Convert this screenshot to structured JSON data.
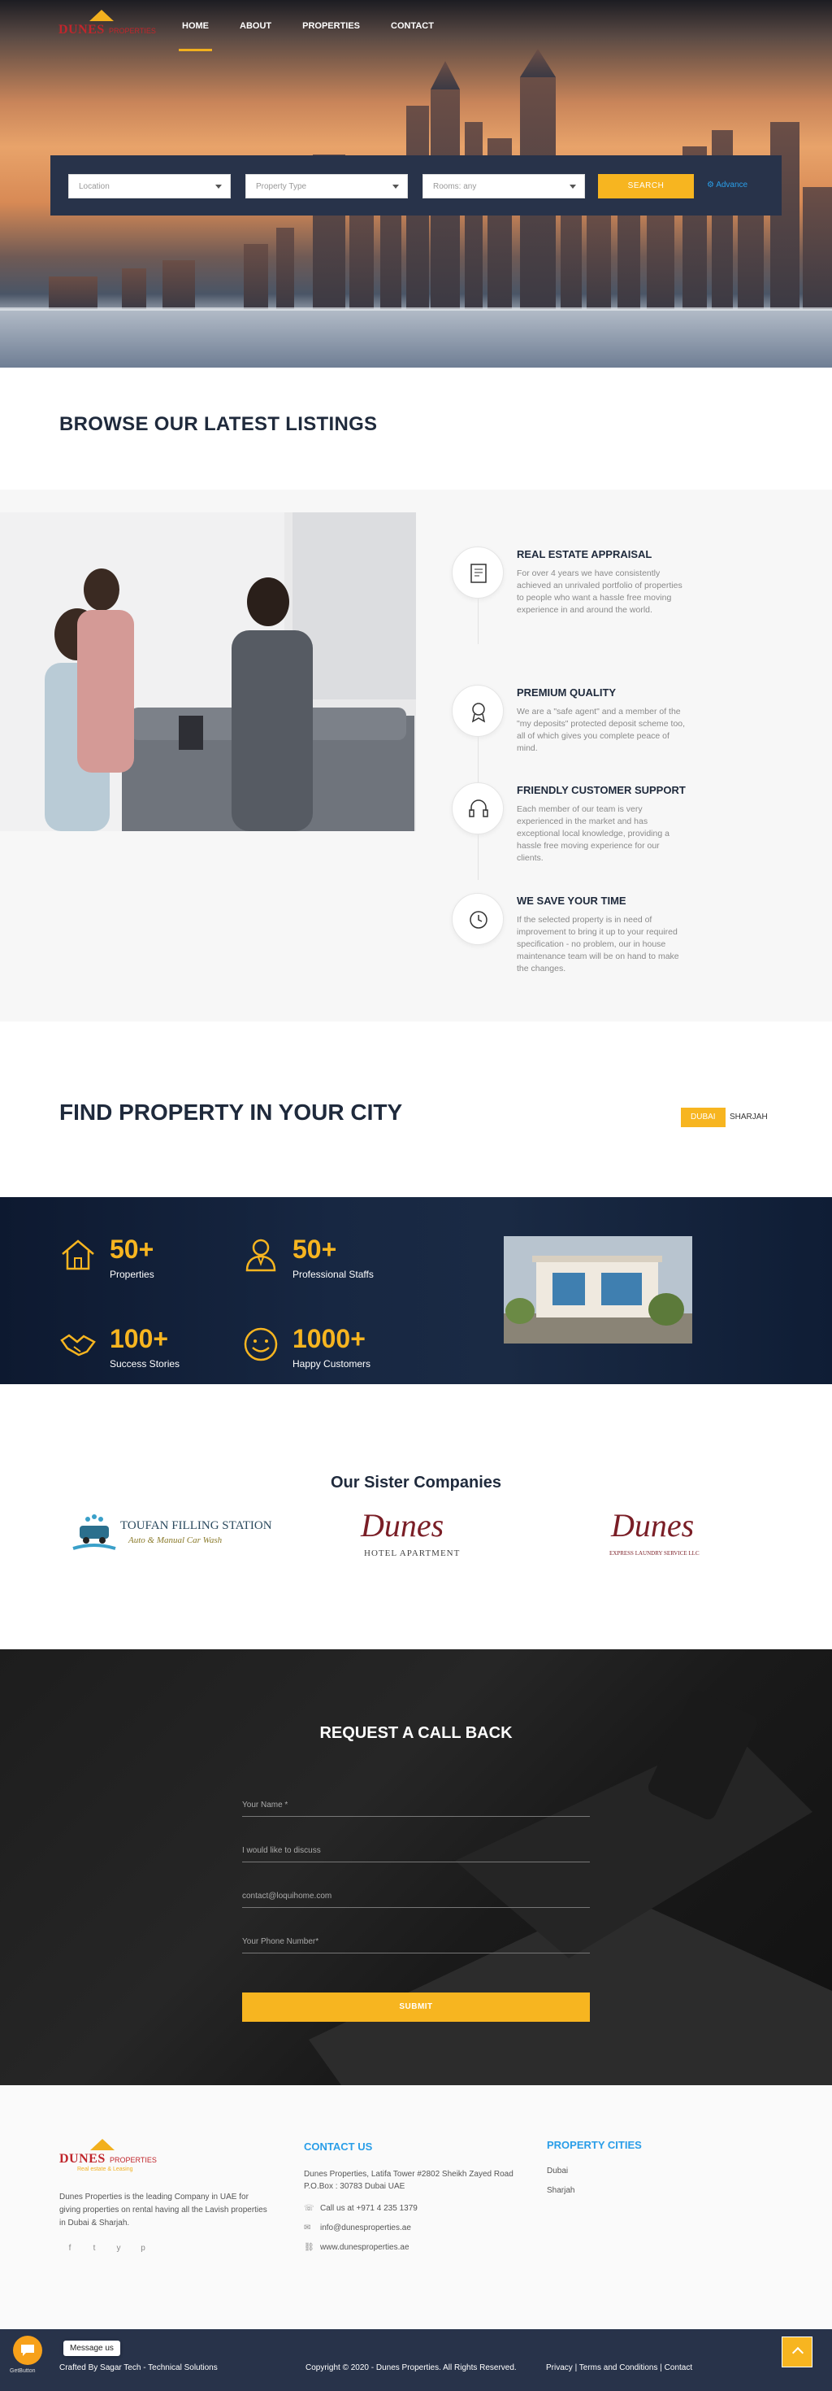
{
  "brand": {
    "name": "DUNES",
    "sub": "PROPERTIES",
    "tagline": "Real estate & Leasing"
  },
  "nav": [
    {
      "label": "HOME",
      "active": true
    },
    {
      "label": "ABOUT"
    },
    {
      "label": "PROPERTIES"
    },
    {
      "label": "CONTACT"
    }
  ],
  "search": {
    "location": "Location",
    "property_type": "Property Type",
    "rooms": "Rooms: any",
    "button": "SEARCH",
    "advance": "Advance"
  },
  "listings": {
    "title": "BROWSE OUR LATEST LISTINGS"
  },
  "features": [
    {
      "icon": "document-icon",
      "title": "REAL ESTATE APPRAISAL",
      "desc": "For over 4 years we have consistently achieved an unrivaled portfolio of properties to people who want a hassle free moving experience in and around the world."
    },
    {
      "icon": "medal-icon",
      "title": "PREMIUM QUALITY",
      "desc": "We are a \"safe agent\" and a member of the \"my deposits\" protected deposit scheme too, all of which gives you complete peace of mind."
    },
    {
      "icon": "headset-icon",
      "title": "FRIENDLY CUSTOMER SUPPORT",
      "desc": "Each member of our team is very experienced in the market and has exceptional local knowledge, providing a hassle free moving experience for our clients."
    },
    {
      "icon": "clock-money-icon",
      "title": "WE SAVE YOUR TIME",
      "desc": "If the selected property is in need of improvement to bring it up to your required specification - no problem, our in house maintenance team will be on hand to make the changes."
    }
  ],
  "city": {
    "title": "FIND PROPERTY IN YOUR CITY",
    "tabs": [
      "DUBAI",
      "SHARJAH"
    ]
  },
  "stats": [
    {
      "icon": "house-icon",
      "value": "50+",
      "label": "Properties"
    },
    {
      "icon": "staff-icon",
      "value": "50+",
      "label": "Professional Staffs"
    },
    {
      "icon": "handshake-icon",
      "value": "100+",
      "label": "Success Stories"
    },
    {
      "icon": "smile-icon",
      "value": "1000+",
      "label": "Happy Customers"
    }
  ],
  "sister": {
    "title": "Our Sister Companies",
    "companies": [
      {
        "name": "TOUFAN FILLING STATION",
        "sub": "Auto & Manual Car Wash"
      },
      {
        "name": "Dunes",
        "sub": "HOTEL APARTMENT"
      },
      {
        "name": "Dunes",
        "sub": "EXPRESS LAUNDRY SERVICE LLC"
      }
    ]
  },
  "callback": {
    "title": "REQUEST A CALL BACK",
    "fields": [
      "Your Name *",
      "I would like to discuss",
      "contact@loquihome.com",
      "Your Phone Number*"
    ],
    "submit": "SUBMIT"
  },
  "footer": {
    "about": "Dunes Properties is the leading Company in UAE for giving properties on rental having all the Lavish properties in Dubai & Sharjah.",
    "social": [
      "f",
      "t",
      "y",
      "p"
    ],
    "contact_title": "CONTACT US",
    "address": "Dunes Properties, Latifa Tower #2802 Sheikh Zayed Road P.O.Box : 30783 Dubai UAE",
    "phone": "Call us at +971 4 235 1379",
    "email": "info@dunesproperties.ae",
    "web": "www.dunesproperties.ae",
    "cities_title": "PROPERTY CITIES",
    "cities": [
      "Dubai",
      "Sharjah"
    ]
  },
  "bottom": {
    "crafted": "Crafted By Sagar Tech - Technical Solutions",
    "copyright": "Copyright © 2020 - Dunes Properties. All Rights Reserved.",
    "privacy": "Privacy",
    "terms": "Terms and Conditions",
    "contact": "Contact"
  },
  "chat": {
    "message": "Message us",
    "brand": "GetButton"
  },
  "colors": {
    "accent": "#f7b520",
    "navy": "#28334a",
    "link": "#2a9ee8"
  }
}
